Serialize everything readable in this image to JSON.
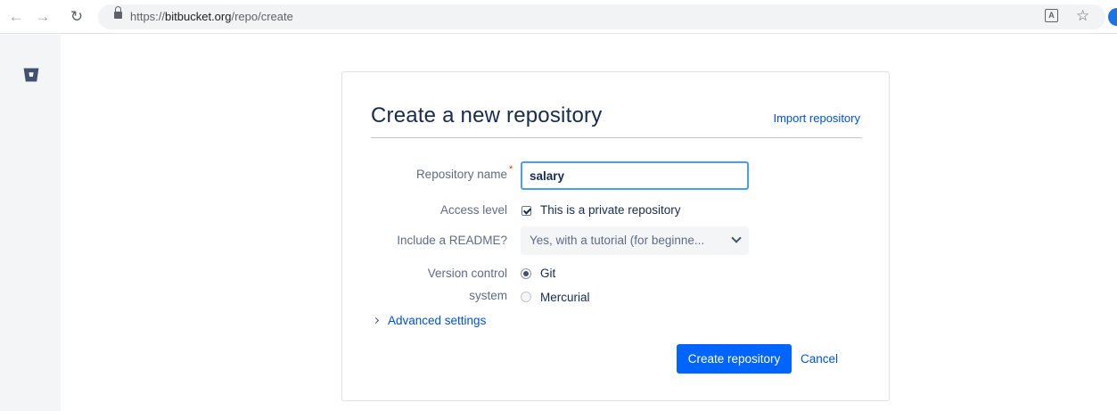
{
  "browser": {
    "url_scheme": "https://",
    "url_host": "bitbucket.org",
    "url_path": "/repo/create",
    "back_icon": "arrow-left-icon",
    "forward_icon": "arrow-right-icon",
    "reload_icon": "reload-icon",
    "translate_icon": "translate-icon",
    "star_icon": "star-icon"
  },
  "sidebar": {
    "logo_icon": "bitbucket-logo-icon"
  },
  "dialog": {
    "title": "Create a new repository",
    "import_link": "Import repository",
    "fields": {
      "repo_name_label": "Repository name",
      "repo_name_required_mark": "*",
      "repo_name_value": "salary",
      "access_label": "Access level",
      "access_option": "This is a private repository",
      "access_checked": true,
      "readme_label": "Include a README?",
      "readme_value": "Yes, with a tutorial (for beginne...",
      "vcs_label_line1": "Version control",
      "vcs_label_line2": "system",
      "vcs_options": [
        {
          "label": "Git",
          "checked": true
        },
        {
          "label": "Mercurial",
          "checked": false
        }
      ]
    },
    "advanced_settings": "Advanced settings",
    "create_button": "Create repository",
    "cancel_link": "Cancel"
  },
  "colors": {
    "primary": "#0065ff",
    "link": "#0052cc",
    "focus_border": "#4c9aff",
    "required": "#de350b",
    "sidebar_bg": "#f4f5f7"
  }
}
